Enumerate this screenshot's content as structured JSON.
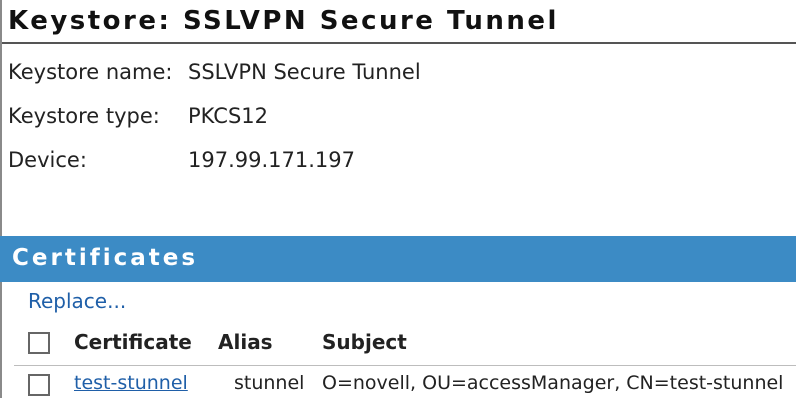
{
  "header": {
    "title": "Keystore: SSLVPN Secure Tunnel"
  },
  "details": {
    "keystore_name_label": "Keystore name:",
    "keystore_name_value": "SSLVPN Secure Tunnel",
    "keystore_type_label": "Keystore type:",
    "keystore_type_value": "PKCS12",
    "device_label": "Device:",
    "device_value": "197.99.171.197"
  },
  "certificates": {
    "section_title": "Certificates",
    "replace_label": "Replace...",
    "columns": [
      "Certificate",
      "Alias",
      "Subject"
    ],
    "rows": [
      {
        "certificate": "test-stunnel",
        "alias": "stunnel",
        "subject": "O=novell, OU=accessManager, CN=test-stunnel"
      }
    ]
  },
  "colors": {
    "section_header_bg": "#3c8bc5",
    "link": "#1f5fa8"
  }
}
